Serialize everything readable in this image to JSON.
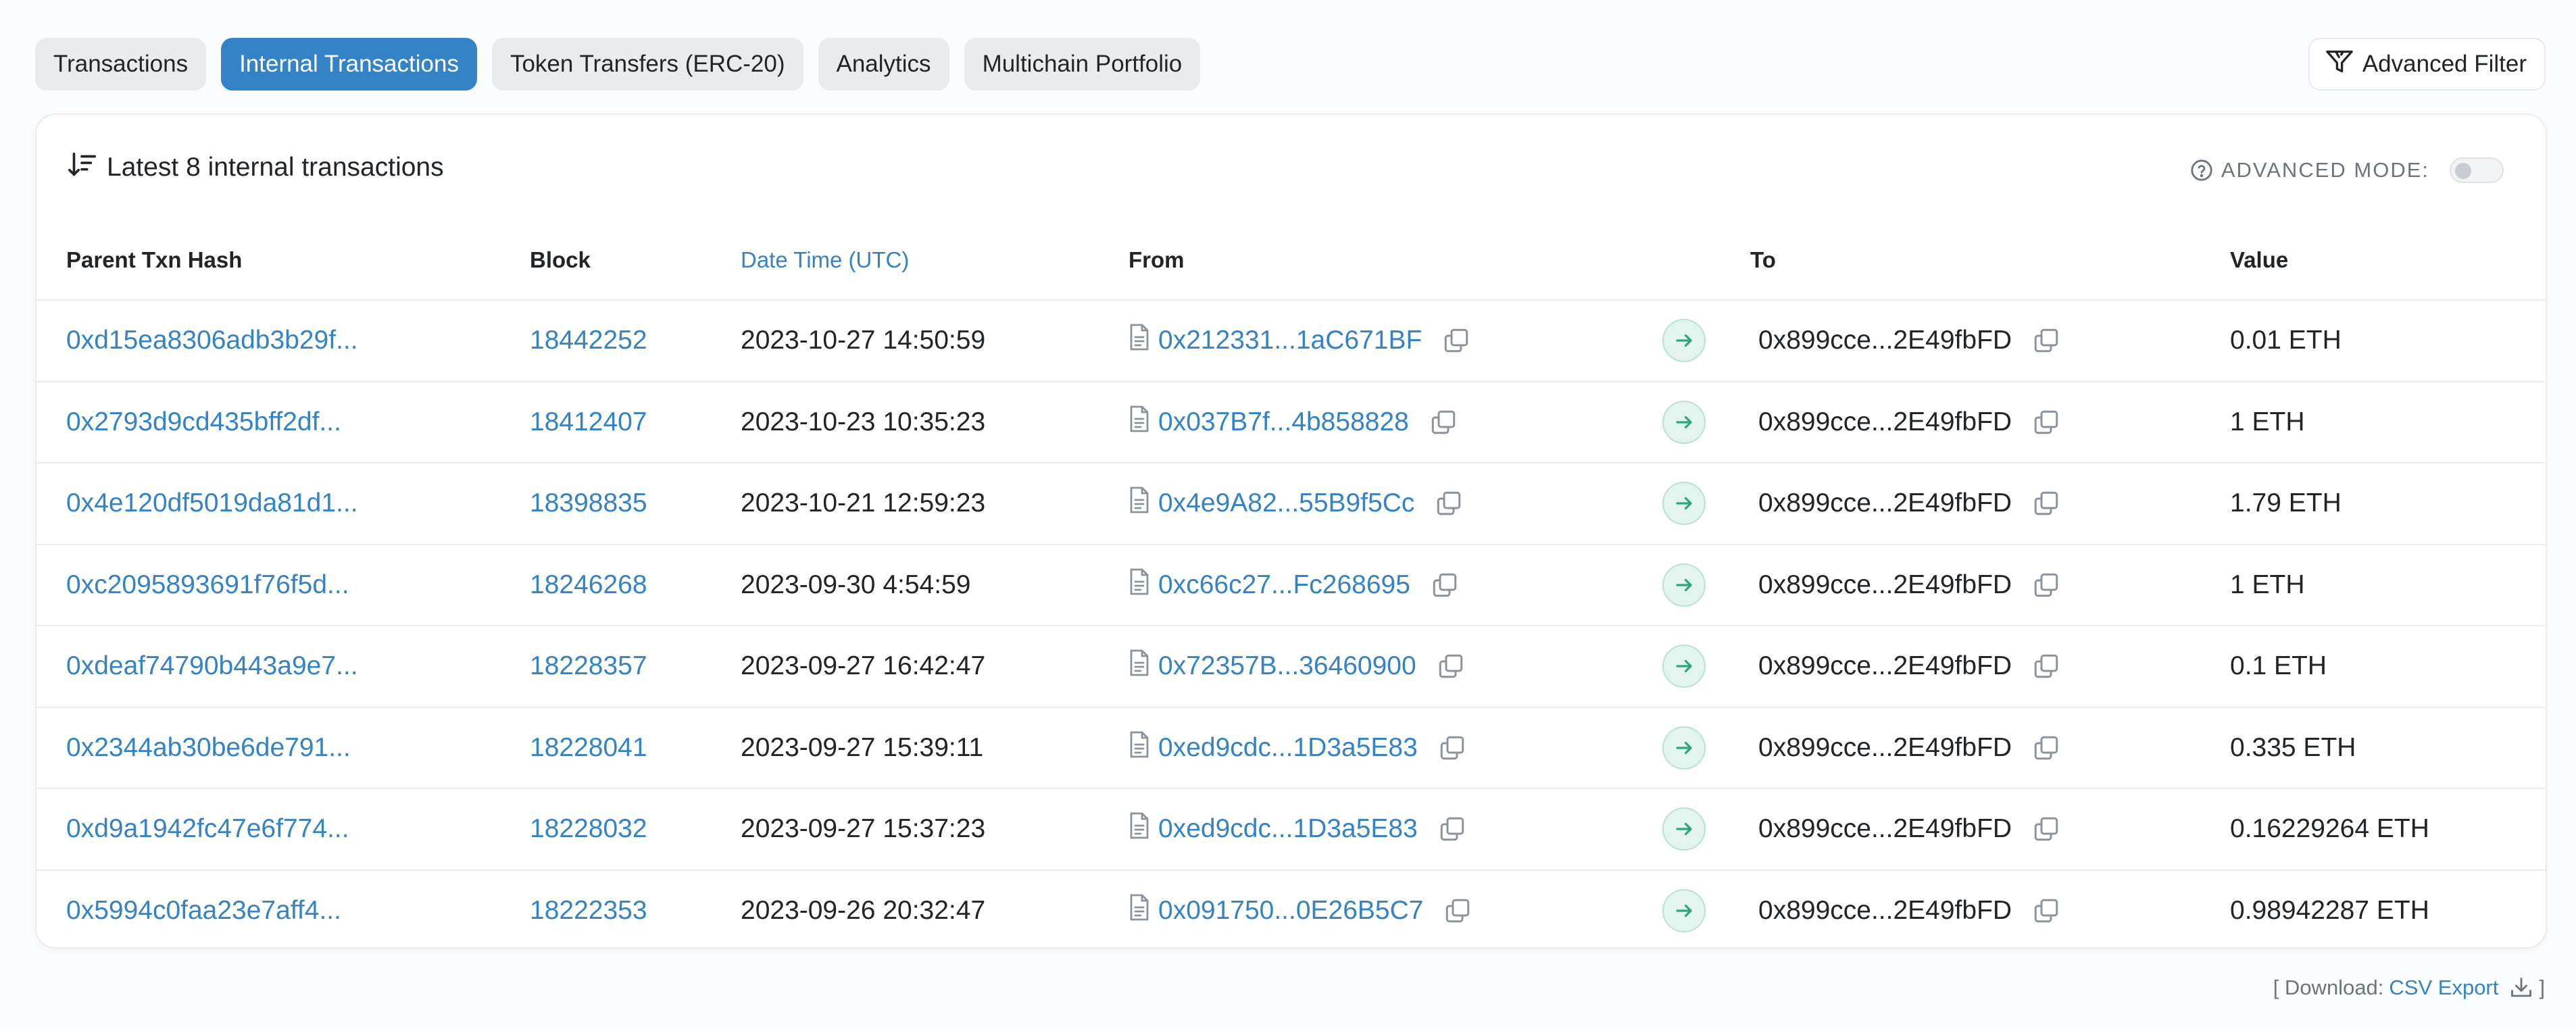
{
  "tabs": [
    {
      "label": "Transactions",
      "active": false
    },
    {
      "label": "Internal Transactions",
      "active": true
    },
    {
      "label": "Token Transfers (ERC-20)",
      "active": false
    },
    {
      "label": "Analytics",
      "active": false
    },
    {
      "label": "Multichain Portfolio",
      "active": false
    }
  ],
  "advanced_filter_label": "Advanced Filter",
  "card": {
    "title": "Latest 8 internal transactions",
    "advanced_mode_label": "ADVANCED MODE:",
    "advanced_mode_on": false
  },
  "table": {
    "headers": {
      "hash": "Parent Txn Hash",
      "block": "Block",
      "date": "Date Time (UTC)",
      "from": "From",
      "to": "To",
      "value": "Value"
    },
    "rows": [
      {
        "hash": "0xd15ea8306adb3b29f...",
        "block": "18442252",
        "date": "2023-10-27 14:50:59",
        "from": "0x212331...1aC671BF",
        "to": "0x899cce...2E49fbFD",
        "value": "0.01 ETH"
      },
      {
        "hash": "0x2793d9cd435bff2df...",
        "block": "18412407",
        "date": "2023-10-23 10:35:23",
        "from": "0x037B7f...4b858828",
        "to": "0x899cce...2E49fbFD",
        "value": "1 ETH"
      },
      {
        "hash": "0x4e120df5019da81d1...",
        "block": "18398835",
        "date": "2023-10-21 12:59:23",
        "from": "0x4e9A82...55B9f5Cc",
        "to": "0x899cce...2E49fbFD",
        "value": "1.79 ETH"
      },
      {
        "hash": "0xc2095893691f76f5d...",
        "block": "18246268",
        "date": "2023-09-30 4:54:59",
        "from": "0xc66c27...Fc268695",
        "to": "0x899cce...2E49fbFD",
        "value": "1 ETH"
      },
      {
        "hash": "0xdeaf74790b443a9e7...",
        "block": "18228357",
        "date": "2023-09-27 16:42:47",
        "from": "0x72357B...36460900",
        "to": "0x899cce...2E49fbFD",
        "value": "0.1 ETH"
      },
      {
        "hash": "0x2344ab30be6de791...",
        "block": "18228041",
        "date": "2023-09-27 15:39:11",
        "from": "0xed9cdc...1D3a5E83",
        "to": "0x899cce...2E49fbFD",
        "value": "0.335 ETH"
      },
      {
        "hash": "0xd9a1942fc47e6f774...",
        "block": "18228032",
        "date": "2023-09-27 15:37:23",
        "from": "0xed9cdc...1D3a5E83",
        "to": "0x899cce...2E49fbFD",
        "value": "0.16229264 ETH"
      },
      {
        "hash": "0x5994c0faa23e7aff4...",
        "block": "18222353",
        "date": "2023-09-26 20:32:47",
        "from": "0x091750...0E26B5C7",
        "to": "0x899cce...2E49fbFD",
        "value": "0.98942287 ETH"
      }
    ]
  },
  "footer": {
    "download_prefix": "[ Download:",
    "csv_label": "CSV Export",
    "suffix": "]"
  },
  "colors": {
    "accent": "#3383c6",
    "arrow_badge_bg": "#e3f4ee",
    "arrow_color": "#2fa57a"
  },
  "icons": {
    "filter": "filter-icon",
    "sort": "sort-icon",
    "help": "question-circle-icon",
    "document": "document-icon",
    "copy": "copy-icon",
    "arrow": "arrow-right-icon",
    "download": "download-icon"
  }
}
